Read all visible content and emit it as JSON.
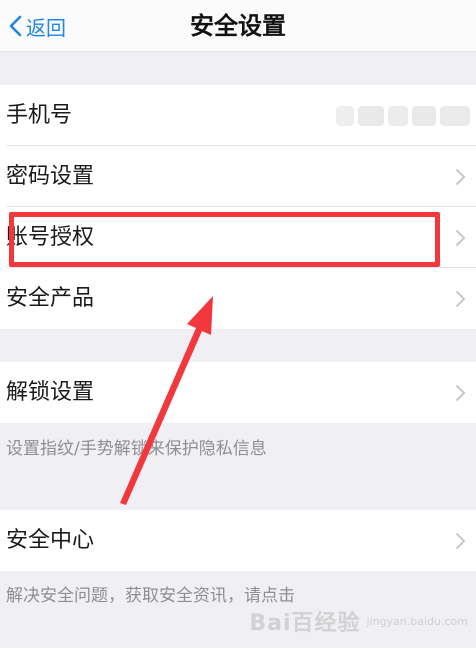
{
  "nav": {
    "back_label": "返回",
    "title": "安全设置"
  },
  "section1": {
    "rows": [
      {
        "label": "手机号",
        "value_hidden": true
      },
      {
        "label": "密码设置"
      },
      {
        "label": "账号授权"
      },
      {
        "label": "安全产品"
      }
    ]
  },
  "section2": {
    "row_label": "解锁设置",
    "hint": "设置指纹/手势解锁来保护隐私信息"
  },
  "section3": {
    "row_label": "安全中心",
    "hint": "解决安全问题，获取安全资讯，请点击"
  },
  "annotation": {
    "highlight_color": "#f2373d",
    "highlighted_item": "账号授权"
  },
  "watermark": {
    "text": "Bai百经验",
    "sub": "jingyan.baidu.com"
  }
}
